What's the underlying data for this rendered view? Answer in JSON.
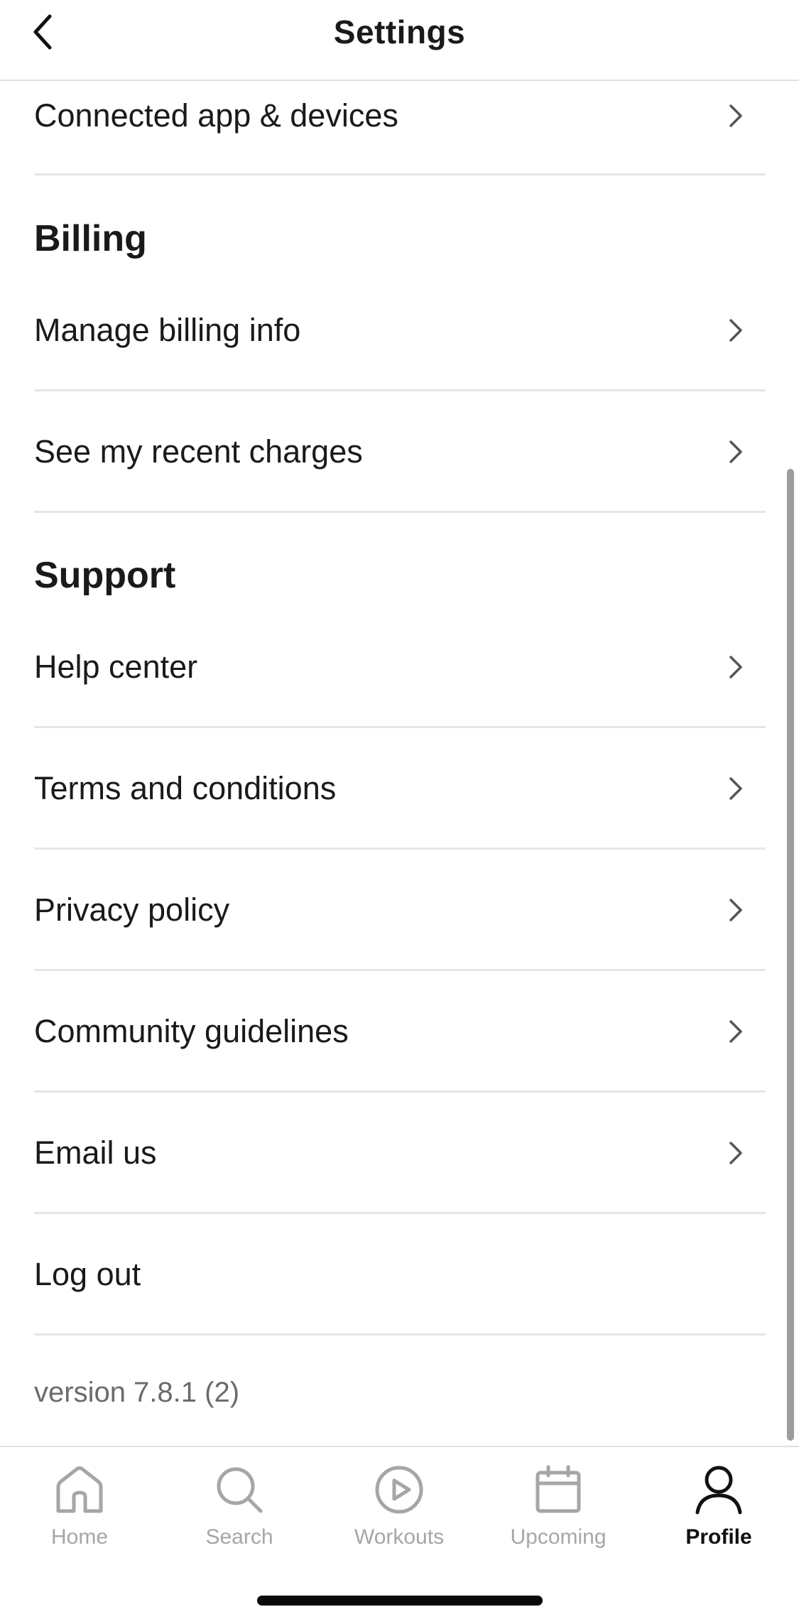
{
  "header": {
    "title": "Settings"
  },
  "connected": {
    "label": "Connected app & devices"
  },
  "billing": {
    "title": "Billing",
    "items": [
      {
        "label": "Manage billing info"
      },
      {
        "label": "See my recent charges"
      }
    ]
  },
  "support": {
    "title": "Support",
    "items": [
      {
        "label": "Help center"
      },
      {
        "label": "Terms and conditions"
      },
      {
        "label": "Privacy policy"
      },
      {
        "label": "Community guidelines"
      },
      {
        "label": "Email us"
      }
    ]
  },
  "logout": {
    "label": "Log out"
  },
  "version": "version 7.8.1 (2)",
  "tabbar": {
    "tabs": [
      {
        "label": "Home",
        "icon": "home-icon"
      },
      {
        "label": "Search",
        "icon": "search-icon"
      },
      {
        "label": "Workouts",
        "icon": "play-circle-icon"
      },
      {
        "label": "Upcoming",
        "icon": "calendar-icon"
      },
      {
        "label": "Profile",
        "icon": "profile-icon"
      }
    ],
    "active": "Profile"
  },
  "colors": {
    "text": "#1a1a1a",
    "muted": "#6b6b6b",
    "inactive_tab": "#a6a6a6",
    "divider": "#e6e6e6"
  }
}
